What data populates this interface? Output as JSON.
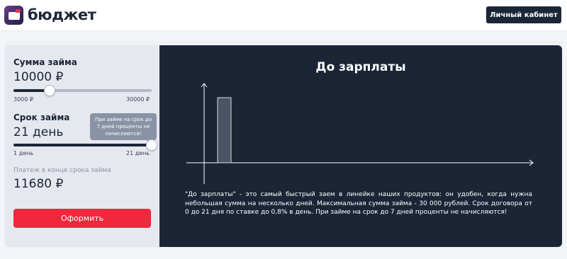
{
  "header": {
    "logo_text": "бюджет",
    "cabinet_button": "Личный кабинет"
  },
  "loan_form": {
    "amount": {
      "label": "Сумма займа",
      "value": "10000 ₽",
      "min_label": "3000 ₽",
      "max_label": "30000 ₽",
      "min": 3000,
      "max": 30000,
      "current": 10000
    },
    "term": {
      "label": "Срок займа",
      "value": "21 день",
      "min_label": "1 день",
      "max_label": "21 день",
      "min": 1,
      "max": 21,
      "current": 21,
      "tooltip": "При займе на срок до 7 дней проценты не начисляются!"
    },
    "payment": {
      "label": "Платеж в конце срока займа",
      "value": "11680 ₽"
    },
    "submit_button": "Оформить"
  },
  "product": {
    "title": "До зарплаты",
    "description": "\"До зарплаты\" - это самый быстрый заем в линейке наших продуктов: он удобен, когда нужна небольшая сумма на несколько дней. Максимальная сумма займа - 30 000 рублей. Срок договора от 0 до 21 дня по ставке до 0,8% в день. При займе на срок до 7 дней проценты не начисляются!"
  },
  "colors": {
    "accent": "#f0283c",
    "dark": "#1c2638",
    "panel": "#e6e8ef"
  }
}
